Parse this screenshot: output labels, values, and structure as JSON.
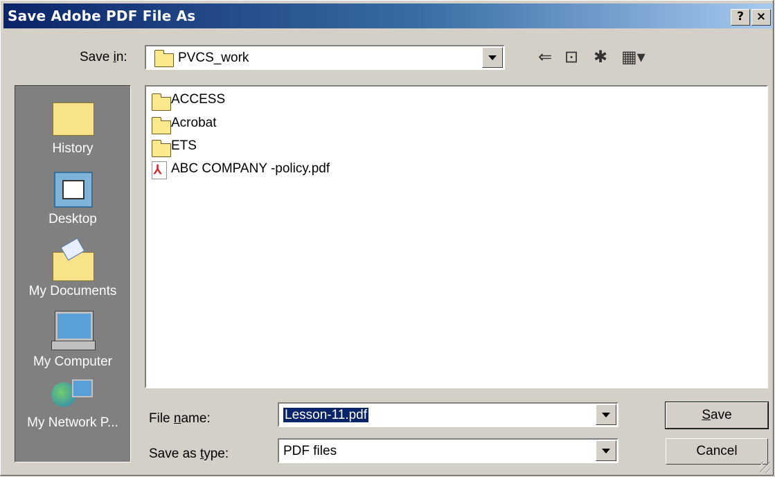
{
  "window": {
    "title": "Save Adobe PDF File As",
    "help_label": "?",
    "close_label": "×"
  },
  "save_in": {
    "label_pre": "Save ",
    "label_u": "i",
    "label_post": "n:",
    "value": "PVCS_work"
  },
  "toolbar": {
    "back_glyph": "⇐",
    "up_glyph": "⊡",
    "new_folder_glyph": "✱",
    "view_glyph": "▦▾"
  },
  "places": [
    {
      "label": "History",
      "icon": "history-icon"
    },
    {
      "label": "Desktop",
      "icon": "desktop-icon"
    },
    {
      "label": "My Documents",
      "icon": "my-documents-icon"
    },
    {
      "label": "My Computer",
      "icon": "my-computer-icon"
    },
    {
      "label": "My Network P...",
      "icon": "my-network-icon"
    }
  ],
  "files": [
    {
      "name": "ACCESS",
      "type": "folder"
    },
    {
      "name": "Acrobat",
      "type": "folder"
    },
    {
      "name": "ETS",
      "type": "folder"
    },
    {
      "name": "ABC COMPANY -policy.pdf",
      "type": "pdf"
    }
  ],
  "file_name": {
    "label_pre": "File ",
    "label_u": "n",
    "label_post": "ame:",
    "value": "Lesson-11.pdf"
  },
  "save_type": {
    "label_pre": "Save as ",
    "label_u": "t",
    "label_post": "ype:",
    "value": "PDF files"
  },
  "buttons": {
    "save_u": "S",
    "save_rest": "ave",
    "cancel": "Cancel"
  }
}
